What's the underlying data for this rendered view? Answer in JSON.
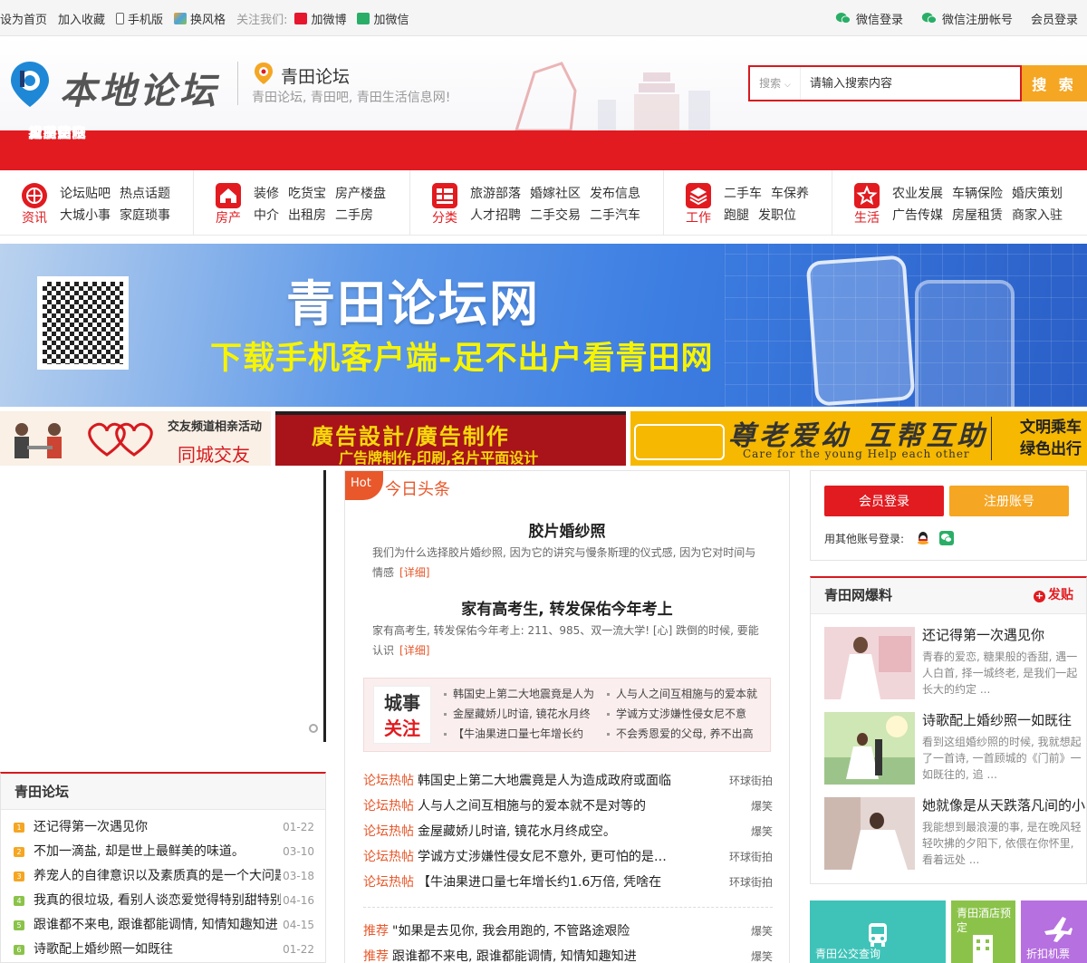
{
  "topbar": {
    "left": [
      "设为首页",
      "加入收藏",
      "手机版",
      "换风格"
    ],
    "follow_label": "关注我们:",
    "weibo": "加微博",
    "weixin": "加微信",
    "right": [
      "微信登录",
      "微信注册帐号",
      "会员登录"
    ]
  },
  "header": {
    "logo_text": "本地论坛",
    "site_name": "青田论坛",
    "slogan": "青田论坛, 青田吧, 青田生活信息网!",
    "search": {
      "type": "搜索",
      "placeholder": "请输入搜索内容",
      "button": "搜 索"
    }
  },
  "nav": [
    "首页",
    "青田贴吧",
    "青田交友",
    "青田新闻",
    "青田信息",
    "青田论坛",
    "青田装修",
    "旅游",
    "招聘",
    "农业",
    "二手房",
    "城市"
  ],
  "quick": [
    {
      "name": "资讯",
      "rows": [
        [
          "论坛贴吧",
          "热点话题"
        ],
        [
          "大城小事",
          "家庭琐事"
        ]
      ]
    },
    {
      "name": "房产",
      "rows": [
        [
          "装修",
          "吃货宝",
          "房产楼盘"
        ],
        [
          "中介",
          "出租房",
          "二手房"
        ]
      ]
    },
    {
      "name": "分类",
      "rows": [
        [
          "旅游部落",
          "婚嫁社区",
          "发布信息"
        ],
        [
          "人才招聘",
          "二手交易",
          "二手汽车"
        ]
      ]
    },
    {
      "name": "工作",
      "rows": [
        [
          "二手车",
          "车保养"
        ],
        [
          "跑腿",
          "发职位"
        ]
      ]
    },
    {
      "name": "生活",
      "rows": [
        [
          "农业发展",
          "车辆保险",
          "婚庆策划"
        ],
        [
          "广告传媒",
          "房屋租赁",
          "商家入驻"
        ]
      ]
    }
  ],
  "banner": {
    "title": "青田论坛网",
    "subtitle": "下载手机客户端-足不出户看青田网"
  },
  "ads": {
    "ad1": {
      "t1": "交友频道相亲活动",
      "t2": "同城交友"
    },
    "ad2": {
      "t1": "廣告設計/廣告制作",
      "t2": "广告牌制作,印刷,名片平面设计"
    },
    "ad3": {
      "t1": "尊老爱幼 互帮互助",
      "t2": "Care for the young    Help each other",
      "t3a": "文明乘车",
      "t3b": "绿色出行"
    }
  },
  "left_panel": {
    "title": "青田论坛",
    "items": [
      {
        "num": "1",
        "title": "还记得第一次遇见你",
        "date": "01-22",
        "color": "#f5a623"
      },
      {
        "num": "2",
        "title": "不加一滴盐, 却是世上最鲜美的味道。",
        "date": "03-10",
        "color": "#f5a623"
      },
      {
        "num": "3",
        "title": "养宠人的自律意识以及素质真的是一个大问题",
        "date": "03-18",
        "color": "#f5a623"
      },
      {
        "num": "4",
        "title": "我真的很垃圾, 看别人谈恋爱觉得特别甜特别",
        "date": "04-16",
        "color": "#8bc34a"
      },
      {
        "num": "5",
        "title": "跟谁都不来电, 跟谁都能调情, 知情知趣知进",
        "date": "04-15",
        "color": "#8bc34a"
      },
      {
        "num": "6",
        "title": "诗歌配上婚纱照一如既往",
        "date": "01-22",
        "color": "#8bc34a"
      }
    ]
  },
  "middle": {
    "hot": "Hot",
    "headline": "今日头条",
    "news": [
      {
        "title": "胶片婚纱照",
        "desc": "我们为什么选择胶片婚纱照, 因为它的讲究与慢条斯理的仪式感, 因为它对时间与情感",
        "more": "[详细]"
      },
      {
        "title": "家有高考生, 转发保佑今年考上",
        "desc": "家有高考生, 转发保佑今年考上: 211、985、双一流大学! [心] 跌倒的时候, 要能认识",
        "more": "[详细]"
      }
    ],
    "city": {
      "tag_a": "城事",
      "tag_b": "关注",
      "links": [
        "韩国史上第二大地震竟是人为",
        "人与人之间互相施与的爱本就",
        "金屋藏娇儿时谙, 镜花水月终",
        "学诚方丈涉嫌性侵女尼不意",
        "【牛油果进口量七年增长约",
        "不会秀恩爱的父母, 养不出高"
      ]
    },
    "hotlist": [
      {
        "tag": "论坛热帖",
        "title": "韩国史上第二大地震竟是人为造成政府或面临",
        "src": "环球街拍"
      },
      {
        "tag": "论坛热帖",
        "title": "人与人之间互相施与的爱本就不是对等的",
        "src": "爆笑"
      },
      {
        "tag": "论坛热帖",
        "title": "金屋藏娇儿时谙, 镜花水月终成空。",
        "src": "爆笑"
      },
      {
        "tag": "论坛热帖",
        "title": "学诚方丈涉嫌性侵女尼不意外, 更可怕的是…",
        "src": "环球街拍"
      },
      {
        "tag": "论坛热帖",
        "title": "【牛油果进口量七年增长约1.6万倍, 凭啥在",
        "src": "环球街拍"
      }
    ],
    "recommend": [
      {
        "tag": "推荐",
        "title": "\"如果是去见你, 我会用跑的, 不管路途艰险",
        "src": "爆笑"
      },
      {
        "tag": "推荐",
        "title": "跟谁都不来电, 跟谁都能调情, 知情知趣知进",
        "src": "爆笑"
      }
    ]
  },
  "right": {
    "login": "会员登录",
    "register": "注册账号",
    "other_login": "用其他账号登录:",
    "expose_title": "青田网爆料",
    "post": "发贴",
    "items": [
      {
        "title": "还记得第一次遇见你",
        "desc": "青春的爱恋, 糖果般的香甜, 遇一人白首, 择一城终老, 是我们一起长大的约定 ..."
      },
      {
        "title": "诗歌配上婚纱照一如既往",
        "desc": "看到这组婚纱照的时候, 我就想起了一首诗, 一首顾城的《门前》一如既往的, 追 ..."
      },
      {
        "title": "她就像是从天跌落凡间的小",
        "desc": "我能想到最浪漫的事, 是在晚风轻轻吹拂的夕阳下, 依偎在你怀里, 看着远处 ..."
      }
    ],
    "tiles": [
      "青田公交查询",
      "青田酒店预定",
      "机票"
    ],
    "tile3_prefix": "折扣"
  },
  "colors": {
    "brand_red": "#e11b20",
    "accent_orange": "#f5a623",
    "hot_orange": "#e8582b"
  }
}
